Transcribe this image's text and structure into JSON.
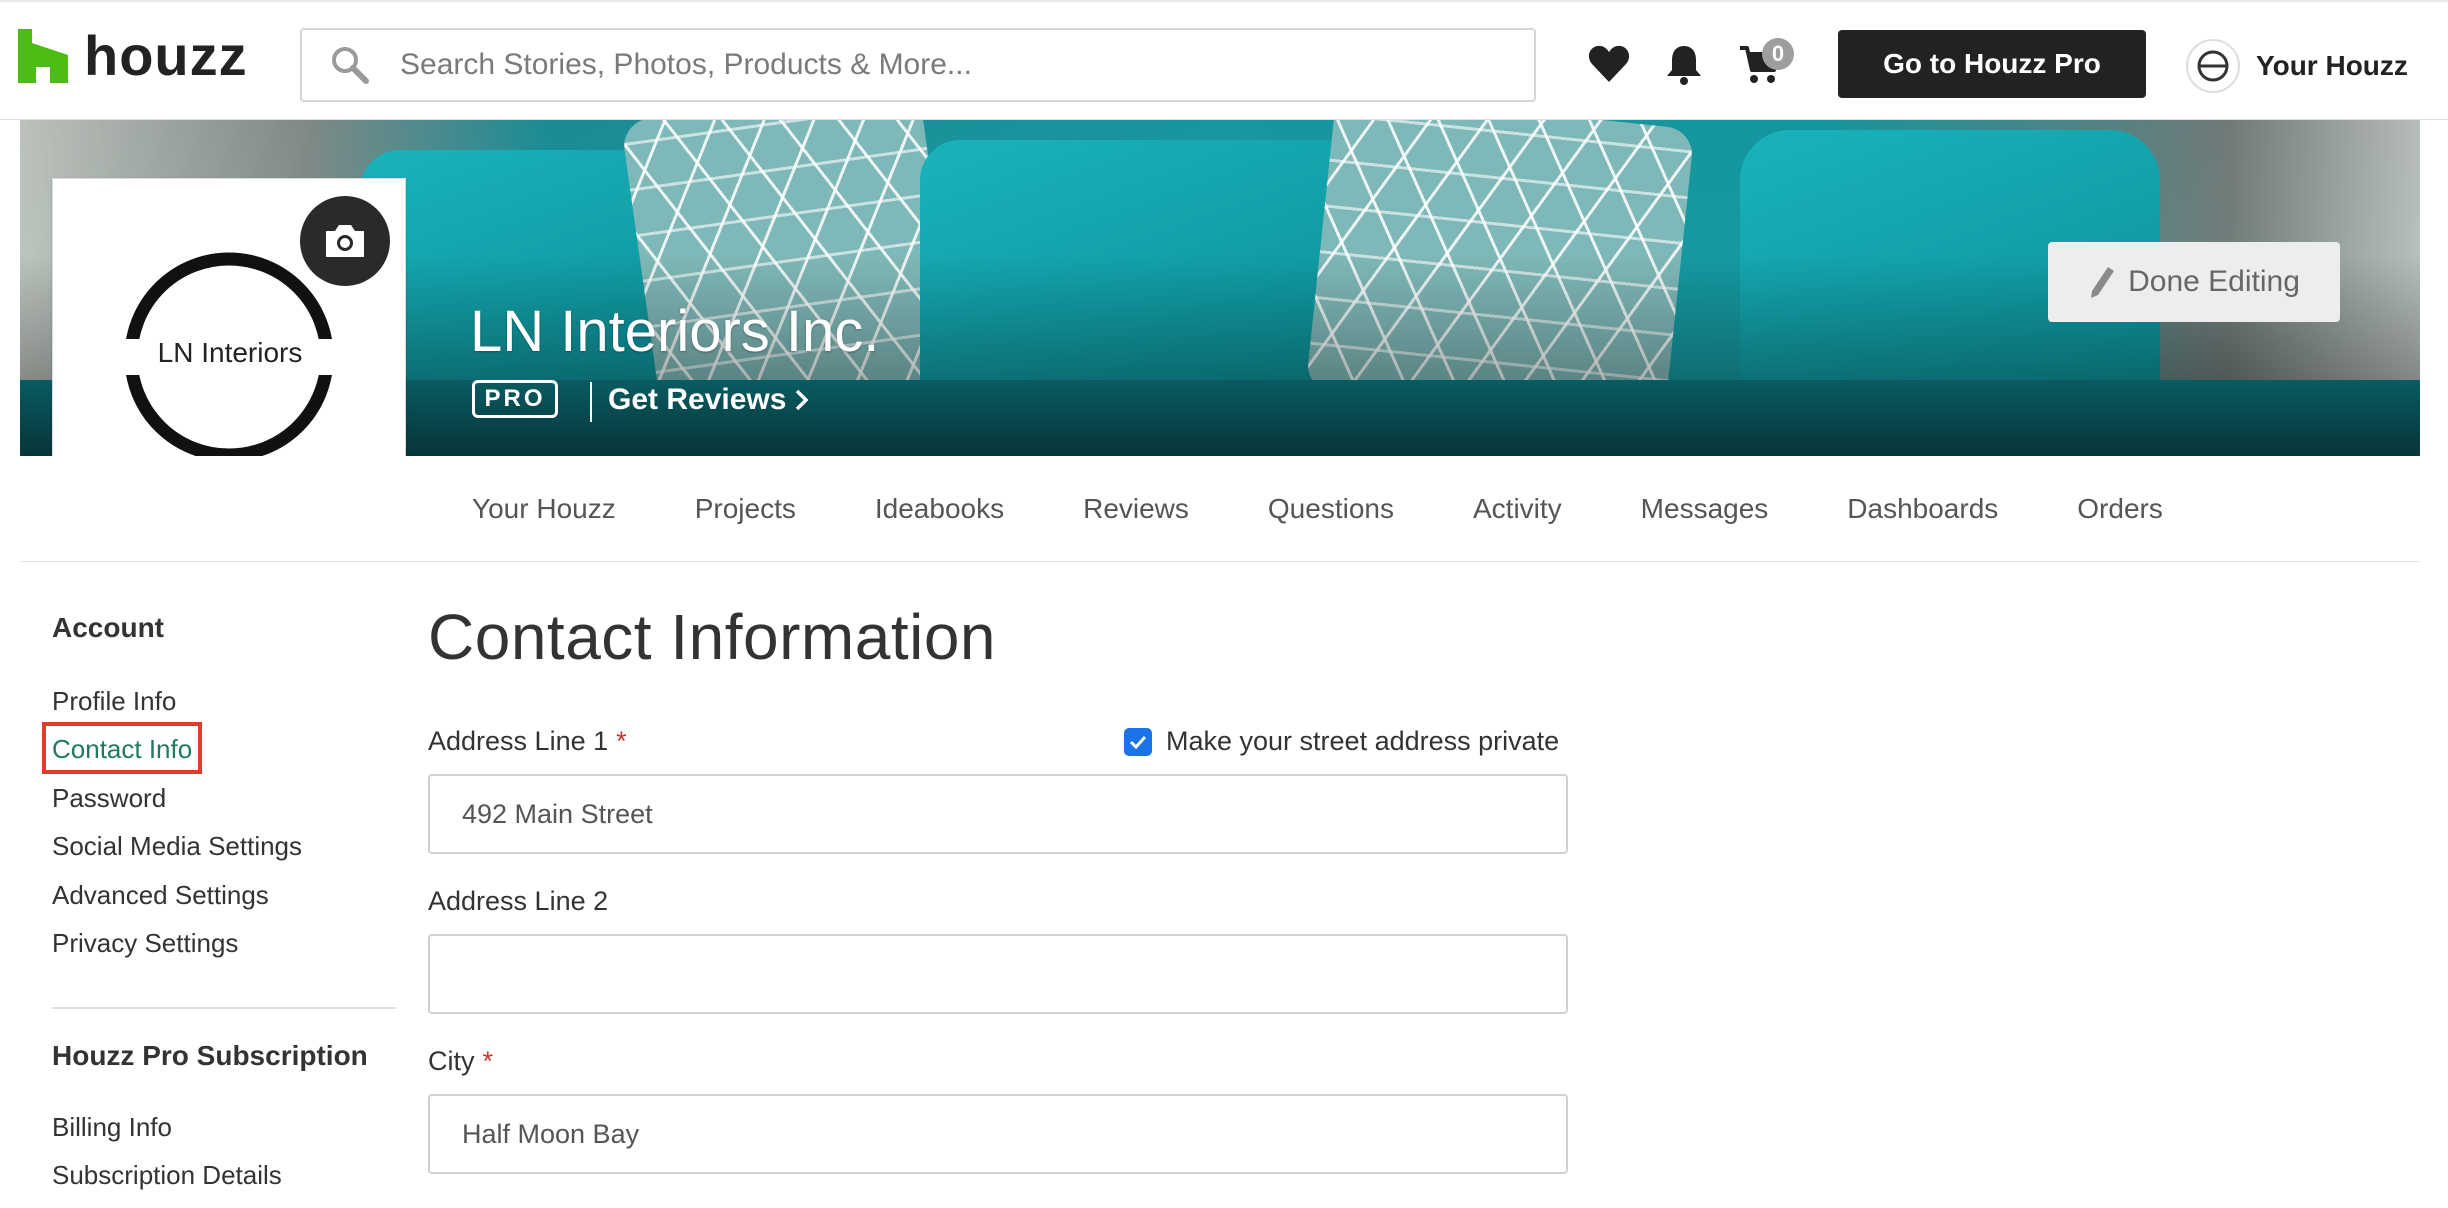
{
  "header": {
    "logo_text": "houzz",
    "search_placeholder": "Search Stories, Photos, Products & More...",
    "cart_count": "0",
    "pro_button": "Go to Houzz Pro",
    "your_houzz": "Your Houzz"
  },
  "profile": {
    "business_name": "LN Interiors Inc.",
    "logo_text": "LN Interiors",
    "badge": "PRO",
    "get_reviews": "Get Reviews",
    "done_editing": "Done Editing"
  },
  "tabs": [
    {
      "label": "Your Houzz"
    },
    {
      "label": "Projects"
    },
    {
      "label": "Ideabooks"
    },
    {
      "label": "Reviews"
    },
    {
      "label": "Questions"
    },
    {
      "label": "Activity"
    },
    {
      "label": "Messages"
    },
    {
      "label": "Dashboards"
    },
    {
      "label": "Orders"
    }
  ],
  "sidebar": {
    "account_heading": "Account",
    "account_items": [
      {
        "label": "Profile Info"
      },
      {
        "label": "Contact Info",
        "active": true
      },
      {
        "label": "Password"
      },
      {
        "label": "Social Media Settings"
      },
      {
        "label": "Advanced Settings"
      },
      {
        "label": "Privacy Settings"
      }
    ],
    "subscription_heading": "Houzz Pro Subscription",
    "subscription_items": [
      {
        "label": "Billing Info"
      },
      {
        "label": "Subscription Details"
      }
    ]
  },
  "form": {
    "title": "Contact Information",
    "address1_label": "Address Line 1",
    "address1_value": "492 Main Street",
    "private_label": "Make your street address private",
    "private_checked": true,
    "address2_label": "Address Line 2",
    "address2_value": "",
    "city_label": "City",
    "city_value": "Half Moon Bay",
    "required_mark": "*"
  },
  "colors": {
    "brand_green": "#4dbc15",
    "active_link": "#217a5f",
    "highlight_box": "#e23b2b",
    "checkbox": "#1a73e8"
  }
}
